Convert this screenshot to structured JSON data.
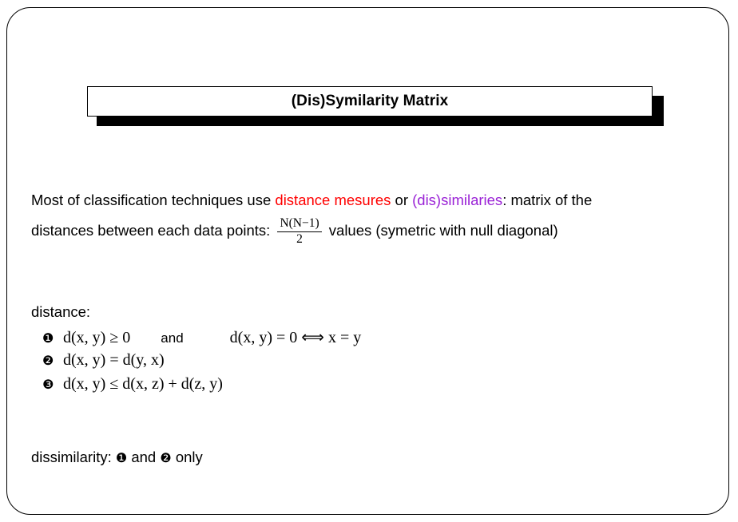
{
  "slide": {
    "title": "(Dis)Symilarity Matrix",
    "intro": {
      "line1_prefix": "Most of classification techniques use ",
      "term_distance": "distance mesures",
      "line1_mid": " or ",
      "term_similarity": "(dis)similaries",
      "line1_suffix": ": matrix of the",
      "line2_prefix": "distances between each data points: ",
      "fraction_numerator": "N(N−1)",
      "fraction_denominator": "2",
      "line2_suffix": " values (symetric with null diagonal)"
    },
    "distance_section": {
      "label": "distance:",
      "properties": [
        {
          "bullet": "❶",
          "expr_left": "d(x, y) ≥ 0",
          "conjunction": "and",
          "expr_right": "d(x, y) = 0 ⟺ x = y"
        },
        {
          "bullet": "❷",
          "expr_left": "d(x, y) = d(y, x)",
          "conjunction": "",
          "expr_right": ""
        },
        {
          "bullet": "❸",
          "expr_left": "d(x, y) ≤ d(x, z) + d(z, y)",
          "conjunction": "",
          "expr_right": ""
        }
      ]
    },
    "footer": {
      "prefix": "dissimilarity: ",
      "bullet_one": "❶",
      "conjunction": " and ",
      "bullet_two": "❷",
      "suffix": " only"
    },
    "colors": {
      "distance_term": "#ff0000",
      "similarity_term": "#9a22d6",
      "text": "#000000",
      "background": "#ffffff"
    }
  }
}
